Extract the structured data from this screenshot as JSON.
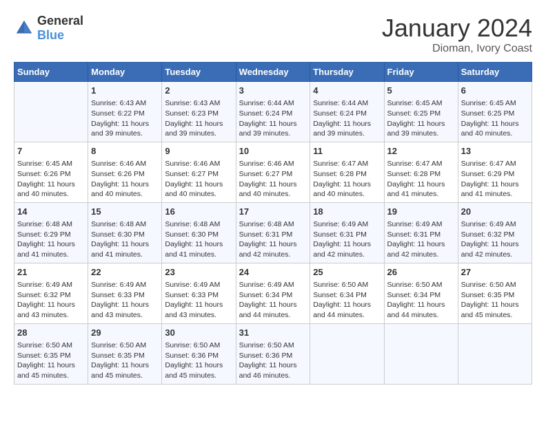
{
  "header": {
    "logo_general": "General",
    "logo_blue": "Blue",
    "month": "January 2024",
    "location": "Dioman, Ivory Coast"
  },
  "days_of_week": [
    "Sunday",
    "Monday",
    "Tuesday",
    "Wednesday",
    "Thursday",
    "Friday",
    "Saturday"
  ],
  "weeks": [
    [
      {
        "day": "",
        "content": ""
      },
      {
        "day": "1",
        "content": "Sunrise: 6:43 AM\nSunset: 6:22 PM\nDaylight: 11 hours\nand 39 minutes."
      },
      {
        "day": "2",
        "content": "Sunrise: 6:43 AM\nSunset: 6:23 PM\nDaylight: 11 hours\nand 39 minutes."
      },
      {
        "day": "3",
        "content": "Sunrise: 6:44 AM\nSunset: 6:24 PM\nDaylight: 11 hours\nand 39 minutes."
      },
      {
        "day": "4",
        "content": "Sunrise: 6:44 AM\nSunset: 6:24 PM\nDaylight: 11 hours\nand 39 minutes."
      },
      {
        "day": "5",
        "content": "Sunrise: 6:45 AM\nSunset: 6:25 PM\nDaylight: 11 hours\nand 39 minutes."
      },
      {
        "day": "6",
        "content": "Sunrise: 6:45 AM\nSunset: 6:25 PM\nDaylight: 11 hours\nand 40 minutes."
      }
    ],
    [
      {
        "day": "7",
        "content": "Sunrise: 6:45 AM\nSunset: 6:26 PM\nDaylight: 11 hours\nand 40 minutes."
      },
      {
        "day": "8",
        "content": "Sunrise: 6:46 AM\nSunset: 6:26 PM\nDaylight: 11 hours\nand 40 minutes."
      },
      {
        "day": "9",
        "content": "Sunrise: 6:46 AM\nSunset: 6:27 PM\nDaylight: 11 hours\nand 40 minutes."
      },
      {
        "day": "10",
        "content": "Sunrise: 6:46 AM\nSunset: 6:27 PM\nDaylight: 11 hours\nand 40 minutes."
      },
      {
        "day": "11",
        "content": "Sunrise: 6:47 AM\nSunset: 6:28 PM\nDaylight: 11 hours\nand 40 minutes."
      },
      {
        "day": "12",
        "content": "Sunrise: 6:47 AM\nSunset: 6:28 PM\nDaylight: 11 hours\nand 41 minutes."
      },
      {
        "day": "13",
        "content": "Sunrise: 6:47 AM\nSunset: 6:29 PM\nDaylight: 11 hours\nand 41 minutes."
      }
    ],
    [
      {
        "day": "14",
        "content": "Sunrise: 6:48 AM\nSunset: 6:29 PM\nDaylight: 11 hours\nand 41 minutes."
      },
      {
        "day": "15",
        "content": "Sunrise: 6:48 AM\nSunset: 6:30 PM\nDaylight: 11 hours\nand 41 minutes."
      },
      {
        "day": "16",
        "content": "Sunrise: 6:48 AM\nSunset: 6:30 PM\nDaylight: 11 hours\nand 41 minutes."
      },
      {
        "day": "17",
        "content": "Sunrise: 6:48 AM\nSunset: 6:31 PM\nDaylight: 11 hours\nand 42 minutes."
      },
      {
        "day": "18",
        "content": "Sunrise: 6:49 AM\nSunset: 6:31 PM\nDaylight: 11 hours\nand 42 minutes."
      },
      {
        "day": "19",
        "content": "Sunrise: 6:49 AM\nSunset: 6:31 PM\nDaylight: 11 hours\nand 42 minutes."
      },
      {
        "day": "20",
        "content": "Sunrise: 6:49 AM\nSunset: 6:32 PM\nDaylight: 11 hours\nand 42 minutes."
      }
    ],
    [
      {
        "day": "21",
        "content": "Sunrise: 6:49 AM\nSunset: 6:32 PM\nDaylight: 11 hours\nand 43 minutes."
      },
      {
        "day": "22",
        "content": "Sunrise: 6:49 AM\nSunset: 6:33 PM\nDaylight: 11 hours\nand 43 minutes."
      },
      {
        "day": "23",
        "content": "Sunrise: 6:49 AM\nSunset: 6:33 PM\nDaylight: 11 hours\nand 43 minutes."
      },
      {
        "day": "24",
        "content": "Sunrise: 6:49 AM\nSunset: 6:34 PM\nDaylight: 11 hours\nand 44 minutes."
      },
      {
        "day": "25",
        "content": "Sunrise: 6:50 AM\nSunset: 6:34 PM\nDaylight: 11 hours\nand 44 minutes."
      },
      {
        "day": "26",
        "content": "Sunrise: 6:50 AM\nSunset: 6:34 PM\nDaylight: 11 hours\nand 44 minutes."
      },
      {
        "day": "27",
        "content": "Sunrise: 6:50 AM\nSunset: 6:35 PM\nDaylight: 11 hours\nand 45 minutes."
      }
    ],
    [
      {
        "day": "28",
        "content": "Sunrise: 6:50 AM\nSunset: 6:35 PM\nDaylight: 11 hours\nand 45 minutes."
      },
      {
        "day": "29",
        "content": "Sunrise: 6:50 AM\nSunset: 6:35 PM\nDaylight: 11 hours\nand 45 minutes."
      },
      {
        "day": "30",
        "content": "Sunrise: 6:50 AM\nSunset: 6:36 PM\nDaylight: 11 hours\nand 45 minutes."
      },
      {
        "day": "31",
        "content": "Sunrise: 6:50 AM\nSunset: 6:36 PM\nDaylight: 11 hours\nand 46 minutes."
      },
      {
        "day": "",
        "content": ""
      },
      {
        "day": "",
        "content": ""
      },
      {
        "day": "",
        "content": ""
      }
    ]
  ]
}
